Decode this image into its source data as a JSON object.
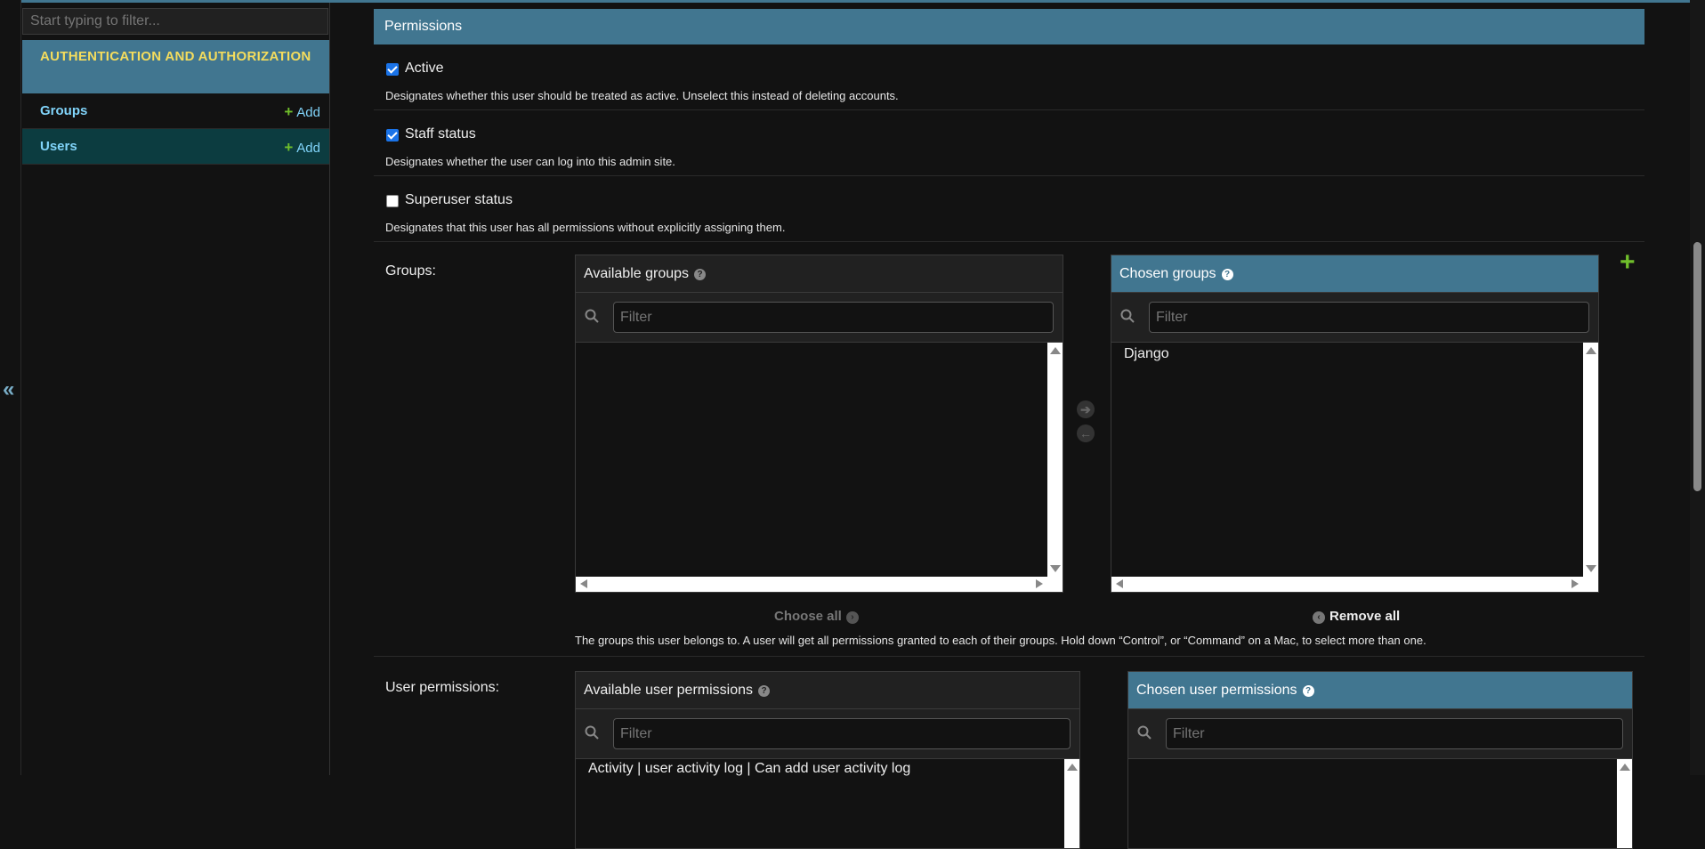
{
  "sidebar": {
    "filter_placeholder": "Start typing to filter...",
    "module_caption": "AUTHENTICATION AND AUTHORIZATION",
    "models": [
      {
        "label": "Groups",
        "add_label": "Add"
      },
      {
        "label": "Users",
        "add_label": "Add"
      }
    ],
    "collapse_glyph": "«"
  },
  "fieldset": {
    "title": "Permissions",
    "active": {
      "label": "Active",
      "checked": true,
      "help": "Designates whether this user should be treated as active. Unselect this instead of deleting accounts."
    },
    "staff": {
      "label": "Staff status",
      "checked": true,
      "help": "Designates whether the user can log into this admin site."
    },
    "superuser": {
      "label": "Superuser status",
      "checked": false,
      "help": "Designates that this user has all permissions without explicitly assigning them."
    }
  },
  "groups": {
    "label": "Groups:",
    "available_title": "Available groups",
    "chosen_title": "Chosen groups",
    "filter_placeholder": "Filter",
    "available_options": [],
    "chosen_options": [
      "Django"
    ],
    "choose_all": "Choose all",
    "remove_all": "Remove all",
    "help": "The groups this user belongs to. A user will get all permissions granted to each of their groups. Hold down “Control”, or “Command” on a Mac, to select more than one."
  },
  "user_permissions": {
    "label": "User permissions:",
    "available_title": "Available user permissions",
    "chosen_title": "Chosen user permissions",
    "filter_placeholder": "Filter",
    "available_options": [
      "Activity | user activity log | Can add user activity log"
    ]
  },
  "icons": {
    "add": "plus-icon",
    "help": "question-circle-icon",
    "search": "magnifier-icon",
    "move_right": "arrow-right-circle-icon",
    "move_left": "arrow-left-circle-icon"
  },
  "colors": {
    "accent": "#417690",
    "module_caption_text": "#f5dd5d",
    "link": "#81d4fa",
    "add_green": "#70bf2b",
    "current_row": "#0c3c40",
    "background": "#121212"
  }
}
